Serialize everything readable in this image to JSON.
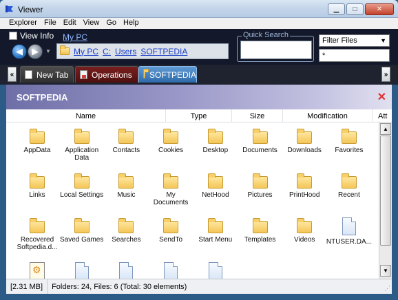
{
  "window": {
    "title": "Viewer"
  },
  "menu": [
    {
      "label": "Explorer"
    },
    {
      "label": "File"
    },
    {
      "label": "Edit"
    },
    {
      "label": "View"
    },
    {
      "label": "Go"
    },
    {
      "label": "Help"
    }
  ],
  "nav": {
    "view_info": "View Info",
    "my_pc_link": "My PC",
    "breadcrumbs": [
      "My PC",
      "C:",
      "Users",
      "SOFTPEDIA"
    ]
  },
  "quick_search": {
    "label": "Quick Search",
    "value": ""
  },
  "filter": {
    "selected": "Filter Files",
    "pattern": "*"
  },
  "tabs": [
    {
      "label": "New Tab",
      "active": false
    },
    {
      "label": "Operations",
      "active": false
    },
    {
      "label": "SOFTPEDIA",
      "active": true
    }
  ],
  "panel": {
    "title": "SOFTPEDIA"
  },
  "columns": [
    "Name",
    "Type",
    "Size",
    "Modification",
    "Att"
  ],
  "items": [
    {
      "label": "AppData",
      "icon": "folder"
    },
    {
      "label": "Application Data",
      "icon": "folder"
    },
    {
      "label": "Contacts",
      "icon": "folder"
    },
    {
      "label": "Cookies",
      "icon": "folder"
    },
    {
      "label": "Desktop",
      "icon": "folder"
    },
    {
      "label": "Documents",
      "icon": "folder"
    },
    {
      "label": "Downloads",
      "icon": "folder"
    },
    {
      "label": "Favorites",
      "icon": "folder"
    },
    {
      "label": "Links",
      "icon": "folder"
    },
    {
      "label": "Local Settings",
      "icon": "folder"
    },
    {
      "label": "Music",
      "icon": "folder"
    },
    {
      "label": "My Documents",
      "icon": "folder"
    },
    {
      "label": "NetHood",
      "icon": "folder"
    },
    {
      "label": "Pictures",
      "icon": "folder"
    },
    {
      "label": "PrintHood",
      "icon": "folder"
    },
    {
      "label": "Recent",
      "icon": "folder"
    },
    {
      "label": "Recovered Softpedia.d...",
      "icon": "folder"
    },
    {
      "label": "Saved Games",
      "icon": "folder"
    },
    {
      "label": "Searches",
      "icon": "folder"
    },
    {
      "label": "SendTo",
      "icon": "folder"
    },
    {
      "label": "Start Menu",
      "icon": "folder"
    },
    {
      "label": "Templates",
      "icon": "folder"
    },
    {
      "label": "Videos",
      "icon": "folder"
    },
    {
      "label": "NTUSER.DA...",
      "icon": "file"
    },
    {
      "label": "",
      "icon": "config-file"
    },
    {
      "label": "",
      "icon": "file"
    },
    {
      "label": "",
      "icon": "file"
    },
    {
      "label": "",
      "icon": "file"
    },
    {
      "label": "",
      "icon": "file"
    }
  ],
  "status": {
    "size": "[2.31 MB]",
    "counts": "Folders: 24, Files: 6  (Total: 30 elements)"
  },
  "colors": {
    "nav_bg": "#13192a",
    "active_tab": "#2e6aa8",
    "panel_header": "#9a98c8"
  }
}
